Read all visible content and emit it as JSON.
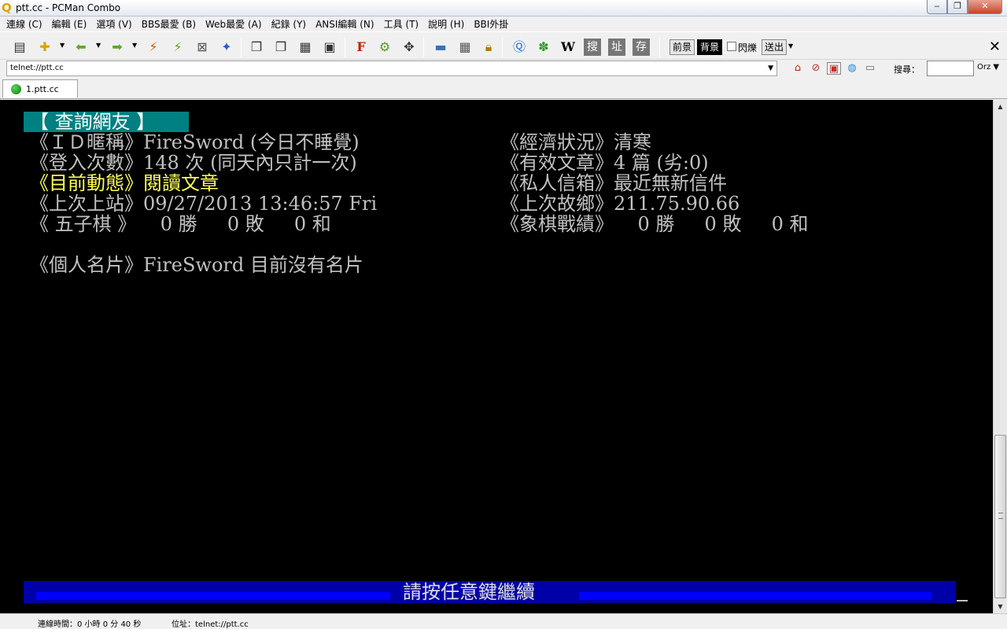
{
  "window": {
    "title": "ptt.cc - PCMan Combo",
    "app_icon": "pcman-icon",
    "controls": {
      "minimize": "‒",
      "maximize": "❐",
      "close": "✕"
    }
  },
  "menu": [
    {
      "label": "連線 (C)"
    },
    {
      "label": "編輯 (E)"
    },
    {
      "label": "選項 (V)"
    },
    {
      "label": "BBS最愛 (B)"
    },
    {
      "label": "Web最愛 (A)"
    },
    {
      "label": "紀錄 (Y)"
    },
    {
      "label": "ANSI編輯 (N)"
    },
    {
      "label": "工具 (T)"
    },
    {
      "label": "說明 (H)"
    },
    {
      "label": "BBI外掛"
    }
  ],
  "toolbar": {
    "search_char": "搜",
    "address_char": "址",
    "save_char": "存",
    "wiki_char": "W",
    "flash_char": "F",
    "fg_label": "前景",
    "bg_label": "背景",
    "blink_label": "閃爍",
    "send_label": "送出"
  },
  "address": {
    "value": "telnet://ptt.cc",
    "search_label": "搜尋：",
    "search_value": "",
    "search_engine": "Orz"
  },
  "tabs": [
    {
      "label": "1.ptt.cc",
      "status_color": "#1a9a1a"
    }
  ],
  "terminal": {
    "header": "【 查詢網友 】",
    "rows": [
      {
        "left": "《ＩＤ暱稱》FireSword (今日不睡覺)",
        "right": "《經濟狀況》清寒"
      },
      {
        "left": "《登入次數》148 次 (同天內只計一次)",
        "right": "《有效文章》4 篇 (劣:0)"
      },
      {
        "left": "《目前動態》閱讀文章",
        "right": "《私人信箱》最近無新信件"
      },
      {
        "left": "《上次上站》09/27/2013 13:46:57 Fri",
        "right": "《上次故鄉》211.75.90.66"
      },
      {
        "left": "《 五子棋 》    0 勝     0 敗     0 和",
        "right": "《象棋戰績》    0 勝     0 敗     0 和"
      }
    ],
    "card": "《個人名片》FireSword 目前沒有名片",
    "press_any_key": "請按任意鍵繼續",
    "colors": {
      "header_bg": "#008080",
      "activity": "#ffff55",
      "prompt_bg": "#0000a8",
      "prompt_stripe": "#0000ff"
    }
  },
  "status": {
    "connection_time": "連線時間：0 小時 0 分 40 秒",
    "address": "位址：telnet://ptt.cc"
  }
}
